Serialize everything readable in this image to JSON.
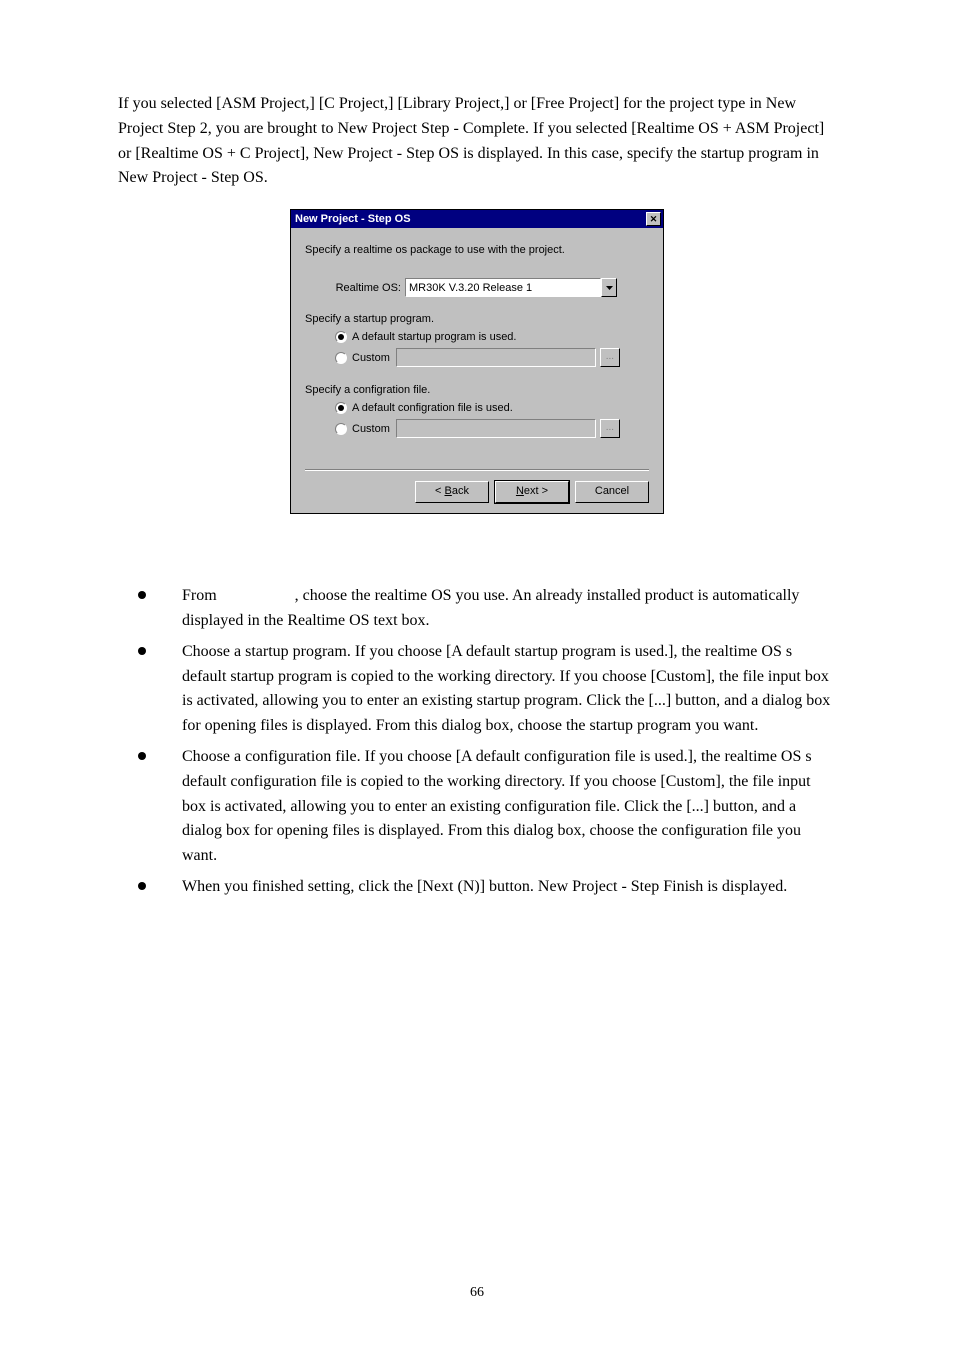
{
  "intro": "If you selected [ASM Project,] [C Project,] [Library Project,] or [Free Project] for the project type in New Project Step 2, you are brought to New Project Step - Complete. If you selected [Realtime OS + ASM Project] or [Realtime OS + C Project], New Project - Step OS is displayed. In this case, specify the startup program in New Project - Step OS.",
  "dialog": {
    "title": "New Project - Step OS",
    "prompt": "Specify a realtime os package to use with the project.",
    "os_label": "Realtime OS:",
    "os_value": "MR30K V.3.20 Release 1",
    "startup": {
      "label": "Specify a startup program.",
      "default": "A default startup program is used.",
      "custom": "Custom"
    },
    "config": {
      "label": "Specify a configration file.",
      "default": "A default configration file is used.",
      "custom": "Custom"
    },
    "browse": "...",
    "buttons": {
      "back_prefix": "< ",
      "back_mn": "B",
      "back_suffix": "ack",
      "next_mn": "N",
      "next_suffix": "ext >",
      "cancel": "Cancel"
    }
  },
  "instructions": {
    "item1_a": "From",
    "item1_b": ", choose the realtime OS you use. An already installed product is automatically displayed in the Realtime OS text box.",
    "item2": "Choose a startup program. If you choose [A default startup program is used.], the realtime OS s default startup program is copied to the working directory. If you choose [Custom], the file input box is activated, allowing you to enter an existing startup program. Click the [...] button, and a dialog box for opening files is displayed. From this dialog box, choose the startup program you want.",
    "item3": "Choose a configuration file. If you choose [A default configuration file is used.], the realtime OS s default configuration file is copied to the working directory. If you choose [Custom], the file input box is activated, allowing you to enter an existing configuration file. Click the [...] button, and a dialog box for opening files is displayed. From this dialog box, choose the configuration file you want.",
    "item4": "When you finished setting, click the [Next (N)] button. New Project - Step Finish is displayed."
  },
  "page_number": "66"
}
